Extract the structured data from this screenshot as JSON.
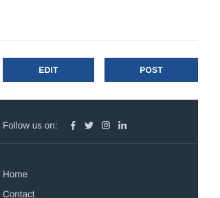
{
  "actions": {
    "edit_label": "EDIT",
    "post_label": "POST",
    "button_color": "#1d4f8f"
  },
  "footer": {
    "background": "#253241",
    "follow_label": "Follow us on:",
    "social": [
      {
        "icon": "facebook-icon"
      },
      {
        "icon": "twitter-icon"
      },
      {
        "icon": "instagram-icon"
      },
      {
        "icon": "linkedin-icon"
      }
    ],
    "links": [
      {
        "label": "Home"
      },
      {
        "label": "Contact"
      }
    ]
  }
}
